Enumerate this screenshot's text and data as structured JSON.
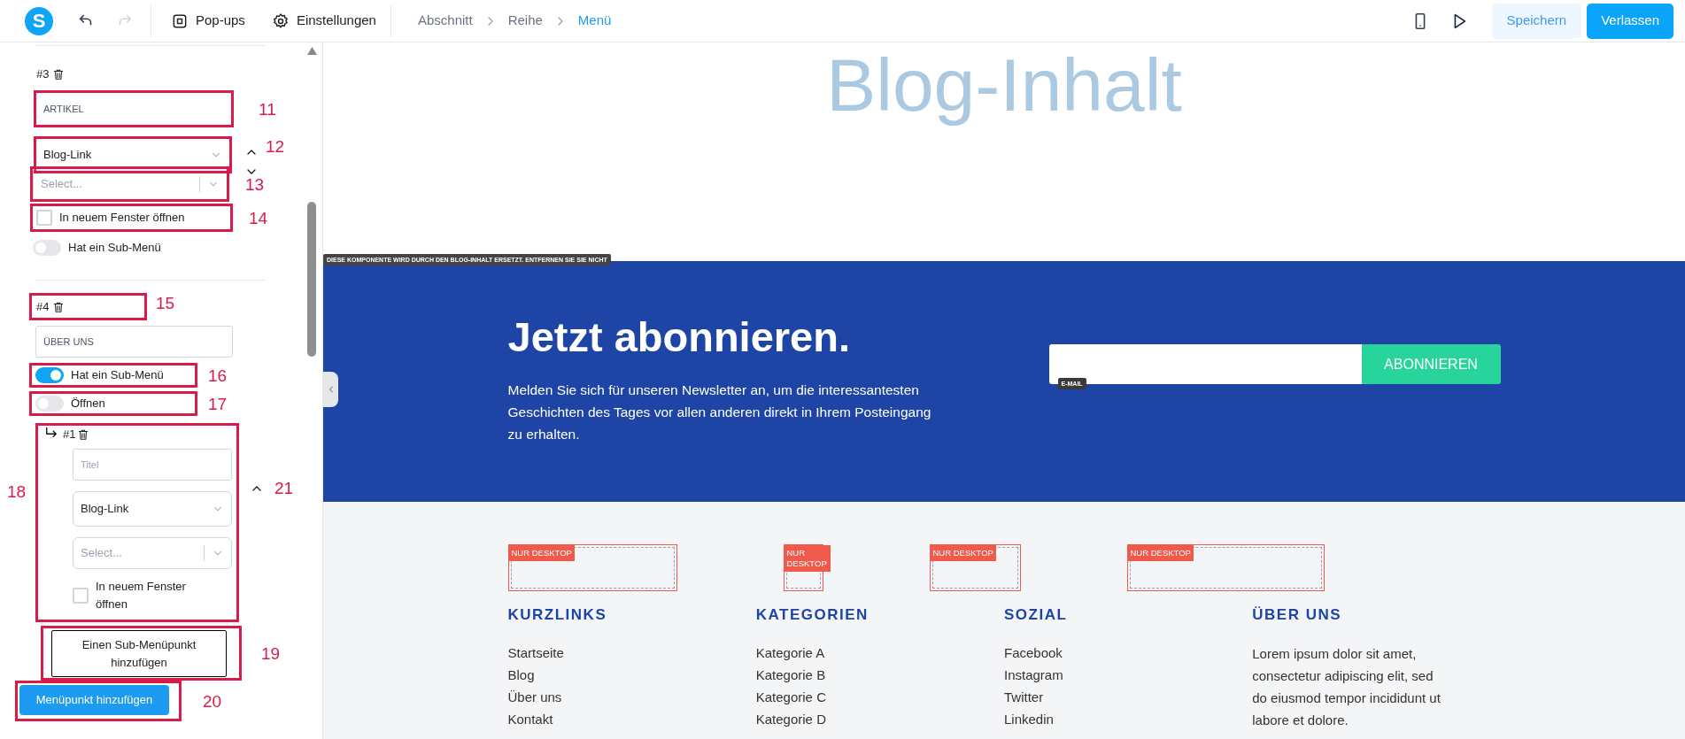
{
  "toolbar": {
    "logo": "S",
    "history": [
      {
        "kind": "undo",
        "disabled": false
      },
      {
        "kind": "redo",
        "disabled": true
      }
    ],
    "tools": [
      {
        "kind": "popups",
        "label": "Pop-ups"
      },
      {
        "kind": "settings",
        "label": "Einstellungen"
      }
    ],
    "breadcrumb": [
      {
        "label": "Abschnitt",
        "selected": false
      },
      {
        "label": "Reihe",
        "selected": false
      },
      {
        "label": "Menü",
        "selected": true
      }
    ],
    "save": "Speichern",
    "leave": "Verlassen"
  },
  "menu_items": [
    {
      "number": "#3",
      "title": {
        "value": "ARTIKEL",
        "callout": "11"
      },
      "link_type": {
        "value": "Blog-Link",
        "callout": "12"
      },
      "target": {
        "placeholder": "Select...",
        "callout": "13"
      },
      "new_window": {
        "label": "In neuem Fenster öffnen",
        "checked": false,
        "callout": "14"
      },
      "submenu": {
        "label": "Hat ein Sub-Menü",
        "on": false
      }
    },
    {
      "number": "#4",
      "number_callout": "15",
      "title": {
        "value": "ÜBER UNS"
      },
      "submenu": {
        "label": "Hat ein Sub-Menü",
        "on": true,
        "callout": "16"
      },
      "open": {
        "label": "Öffnen",
        "on": false,
        "callout": "17"
      },
      "children": [
        {
          "number": "#1",
          "callout": "18",
          "chevron_callout": "21",
          "title": {
            "placeholder": "Titel"
          },
          "link_type": {
            "value": "Blog-Link"
          },
          "target": {
            "placeholder": "Select..."
          },
          "new_window": {
            "label": "In neuem Fenster öffnen",
            "checked": false
          }
        }
      ],
      "add_child": {
        "label": "Einen Sub-Menüpunkt hinzufügen",
        "callout": "19"
      }
    }
  ],
  "add_item": {
    "label": "Menüpunkt hinzufügen",
    "callout": "20"
  },
  "canvas": {
    "blog_placeholder": "Blog-Inhalt",
    "notice": "DIESE KOMPONENTE WIRD DURCH DEN BLOG-INHALT ERSETZT. ENTFERNEN SIE SIE NICHT",
    "newsletter": {
      "heading": "Jetzt abonnieren.",
      "text": "Melden Sie sich für unseren Newsletter an, um die interessantesten Geschichten des Tages vor allen anderen direkt in Ihrem Posteingang zu erhalten.",
      "email_badge": "E-MAIL",
      "button": "ABONNIEREN"
    },
    "desktop_badges": [
      "NUR DESKTOP",
      "NUR DESKTOP",
      "NUR DESKTOP",
      "NUR DESKTOP"
    ],
    "footer_columns": [
      {
        "kind": "links",
        "heading": "KURZLINKS",
        "links": [
          "Startseite",
          "Blog",
          "Über uns",
          "Kontakt"
        ]
      },
      {
        "kind": "links",
        "heading": "KATEGORIEN",
        "links": [
          "Kategorie A",
          "Kategorie B",
          "Kategorie C",
          "Kategorie D"
        ]
      },
      {
        "kind": "links",
        "heading": "SOZIAL",
        "links": [
          "Facebook",
          "Instagram",
          "Twitter",
          "Linkedin"
        ]
      },
      {
        "kind": "text",
        "heading": "ÜBER UNS",
        "text": "Lorem ipsum dolor sit amet, consectetur adipiscing elit, sed do eiusmod tempor incididunt ut labore et dolore."
      }
    ]
  }
}
